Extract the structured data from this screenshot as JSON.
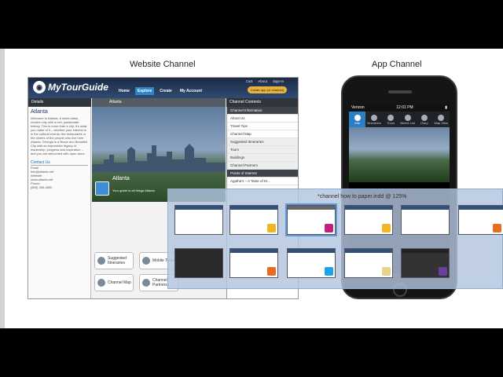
{
  "headings": {
    "website": "Website Channel",
    "app": "App Channel"
  },
  "site": {
    "logo": "MyTourGuide",
    "top_links": [
      "Cart",
      "About",
      "Sign-in"
    ],
    "nav": [
      "Home",
      "Explore",
      "Create",
      "My Account"
    ],
    "cta": "Create app (or channel)",
    "details_label": "Details",
    "location_label": "Atlanta",
    "channel_contents_label": "Channel Contents",
    "left": {
      "city": "Atlanta",
      "description": "Welcome to Atlanta, a world-class, modern city with a rich, passionate history. This is more than a city; it's what you make of it – whether your interest is in the cultural events, the restaurants or the stories of the people who live here. Atlanta, Georgia is a Brave and Beautiful City with an impressive legacy of leadership, progress and inspiration – and you are welcomed with open arms.",
      "contact_title": "Contact Us",
      "contact": [
        "Email",
        "info@atlanta.net",
        "Website",
        "www.atlanta.net",
        "Phone",
        "(800) 285-4800"
      ]
    },
    "hero_caption": {
      "title": "Atlanta",
      "subtitle": "Your guide to all things Atlanta"
    },
    "tiles": [
      "Suggested Itineraries",
      "Mobile Tours",
      "Channel Map",
      "Channel Partners"
    ],
    "right_items": [
      "Channel Information",
      "About Us",
      "Travel Tips",
      "Channel Map",
      "Suggested Itineraries",
      "Tours",
      "Buildings",
      "Channel Partners",
      "Points of Interest"
    ],
    "poi_entry": "Agatha's – A Taste of M..."
  },
  "phone": {
    "carrier": "Verizon",
    "time": "12:01 PM",
    "tabs": [
      "Info",
      "Itineraries",
      "Tours",
      "Bkmrk List",
      "Diary",
      "Map View"
    ]
  },
  "switcher": {
    "title": "*channel how to paper.indd @ 125%",
    "thumbs": 11
  }
}
